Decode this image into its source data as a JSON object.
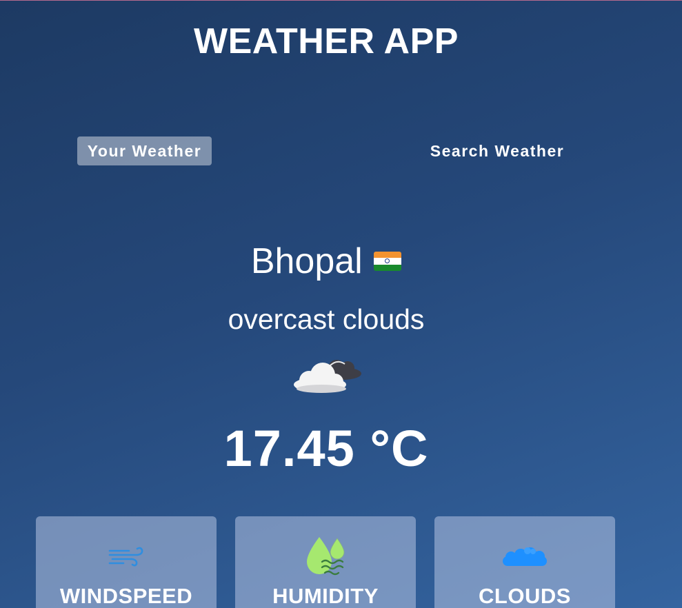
{
  "app": {
    "title": "WEATHER APP"
  },
  "tabs": [
    {
      "label": "Your Weather",
      "active": true
    },
    {
      "label": "Search Weather",
      "active": false
    }
  ],
  "weather": {
    "city": "Bhopal",
    "country_flag": "india-flag-icon",
    "description": "overcast clouds",
    "condition_icon": "overcast-clouds-icon",
    "temperature": "17.45 °C"
  },
  "cards": [
    {
      "label": "WINDSPEED",
      "icon": "wind-icon",
      "icon_color": "#2f8ee0"
    },
    {
      "label": "HUMIDITY",
      "icon": "humidity-drops-icon",
      "icon_color": "#a6e86f"
    },
    {
      "label": "CLOUDS",
      "icon": "clouds-icon",
      "icon_color": "#1e90ff"
    }
  ],
  "colors": {
    "background_top": "#1d3a63",
    "background_bottom": "#3464a0",
    "active_tab_bg": "rgba(255,255,255,0.42)",
    "card_bg": "rgba(180,195,225,0.55)"
  }
}
